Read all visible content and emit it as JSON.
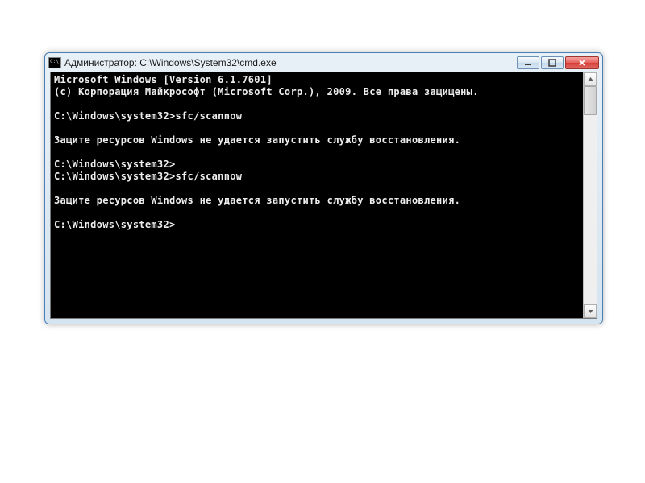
{
  "window": {
    "title": "Администратор: C:\\Windows\\System32\\cmd.exe"
  },
  "console": {
    "lines": [
      "Microsoft Windows [Version 6.1.7601]",
      "(c) Корпорация Майкрософт (Microsoft Corp.), 2009. Все права защищены.",
      "",
      "C:\\Windows\\system32>sfc/scannow",
      "",
      "Защите ресурсов Windows не удается запустить службу восстановления.",
      "",
      "C:\\Windows\\system32>",
      "C:\\Windows\\system32>sfc/scannow",
      "",
      "Защите ресурсов Windows не удается запустить службу восстановления.",
      "",
      "C:\\Windows\\system32>"
    ]
  }
}
